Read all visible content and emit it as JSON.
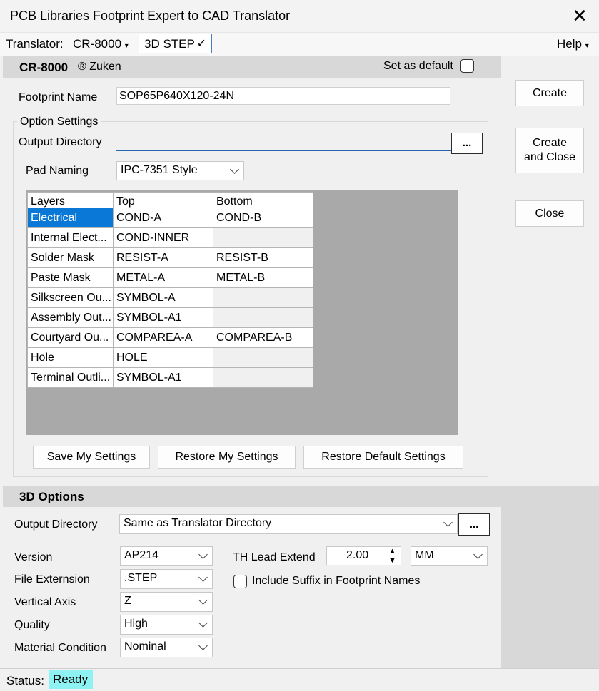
{
  "window": {
    "title": "PCB Libraries Footprint Expert to CAD Translator",
    "close_glyph": "✕"
  },
  "menu": {
    "translator_label": "Translator:",
    "translator_value": "CR-8000",
    "step_label": "3D STEP",
    "step_check": "✓",
    "help_label": "Help"
  },
  "header": {
    "name": "CR-8000",
    "vendor": "® Zuken",
    "set_default_label": "Set as default"
  },
  "footprint": {
    "label": "Footprint Name",
    "value": "SOP65P640X120-24N"
  },
  "option_settings": {
    "title": "Option Settings",
    "output_dir_label": "Output Directory",
    "output_dir_value": "",
    "browse_label": "...",
    "pad_naming_label": "Pad Naming",
    "pad_naming_value": "IPC-7351 Style"
  },
  "layers_table": {
    "headers": [
      "Layers",
      "Top",
      "Bottom"
    ],
    "rows": [
      [
        "Electrical",
        "COND-A",
        "COND-B"
      ],
      [
        "Internal Elect...",
        "COND-INNER",
        ""
      ],
      [
        "Solder Mask",
        "RESIST-A",
        "RESIST-B"
      ],
      [
        "Paste Mask",
        "METAL-A",
        "METAL-B"
      ],
      [
        "Silkscreen Ou...",
        "SYMBOL-A",
        ""
      ],
      [
        "Assembly Out...",
        "SYMBOL-A1",
        ""
      ],
      [
        "Courtyard Ou...",
        "COMPAREA-A",
        "COMPAREA-B"
      ],
      [
        "Hole",
        "HOLE",
        ""
      ],
      [
        "Terminal Outli...",
        "SYMBOL-A1",
        ""
      ]
    ],
    "selected_row": 0
  },
  "settings_buttons": {
    "save": "Save My Settings",
    "restore": "Restore My Settings",
    "restore_default": "Restore Default Settings"
  },
  "side_buttons": {
    "create": "Create",
    "create_close_line1": "Create",
    "create_close_line2": "and Close",
    "close": "Close"
  },
  "options_3d": {
    "title": "3D Options",
    "output_dir_label": "Output Directory",
    "output_dir_value": "Same as Translator Directory",
    "browse_label": "...",
    "version_label": "Version",
    "version_value": "AP214",
    "file_ext_label": "File Externsion",
    "file_ext_value": ".STEP",
    "vertical_axis_label": "Vertical Axis",
    "vertical_axis_value": "Z",
    "quality_label": "Quality",
    "quality_value": "High",
    "material_label": "Material Condition",
    "material_value": "Nominal",
    "th_lead_label": "TH Lead Extend",
    "th_lead_value": "2.00",
    "unit_value": "MM",
    "include_suffix_label": "Include Suffix in Footprint Names"
  },
  "status": {
    "label": "Status:",
    "value": "Ready"
  }
}
